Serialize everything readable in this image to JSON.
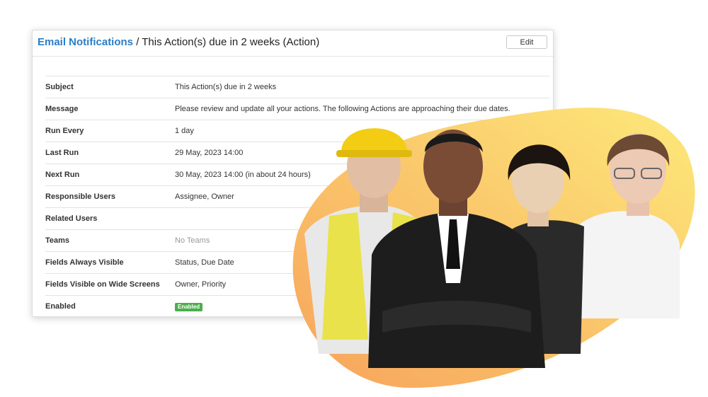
{
  "header": {
    "breadcrumb_link": "Email Notifications",
    "separator": " / ",
    "title": "This Action(s) due in 2 weeks (Action)",
    "edit_label": "Edit"
  },
  "fields": [
    {
      "label": "Subject",
      "value": "This Action(s) due in 2 weeks"
    },
    {
      "label": "Message",
      "value": "Please review and update all your actions. The following Actions are approaching their due dates."
    },
    {
      "label": "Run Every",
      "value": "1 day"
    },
    {
      "label": "Last Run",
      "value": "29 May, 2023 14:00"
    },
    {
      "label": "Next Run",
      "value": "30 May, 2023 14:00 (in about 24 hours)"
    },
    {
      "label": "Responsible Users",
      "value": "Assignee, Owner"
    },
    {
      "label": "Related Users",
      "value": ""
    },
    {
      "label": "Teams",
      "value": "No Teams"
    },
    {
      "label": "Fields Always Visible",
      "value": "Status, Due Date"
    },
    {
      "label": "Fields Visible on Wide Screens",
      "value": "Owner, Priority"
    },
    {
      "label": "Enabled",
      "badge": "Enabled"
    }
  ],
  "colors": {
    "link": "#2a7ec6",
    "badge": "#4cae4c",
    "blob_start": "#f7a35c",
    "blob_end": "#fde97a"
  }
}
